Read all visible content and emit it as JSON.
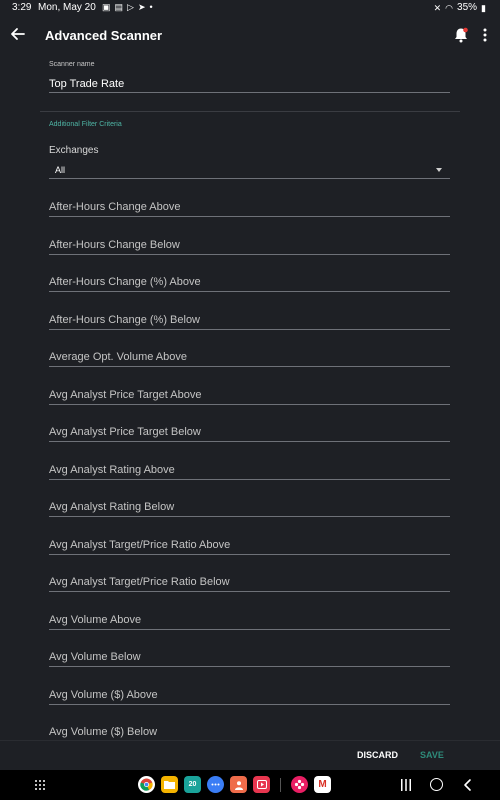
{
  "status_bar": {
    "time": "3:29",
    "date": "Mon, May 20",
    "battery": "35%"
  },
  "app_bar": {
    "title": "Advanced Scanner"
  },
  "scanner_name": {
    "label": "Scanner name",
    "value": "Top Trade Rate"
  },
  "section": {
    "title": "Additional Filter Criteria"
  },
  "exchanges": {
    "label": "Exchanges",
    "selected": "All"
  },
  "filters": [
    "After-Hours Change Above",
    "After-Hours Change Below",
    "After-Hours Change (%) Above",
    "After-Hours Change (%) Below",
    "Average Opt. Volume Above",
    "Avg Analyst Price Target Above",
    "Avg Analyst Price Target Below",
    "Avg Analyst Rating Above",
    "Avg Analyst Rating Below",
    "Avg Analyst Target/Price Ratio Above",
    "Avg Analyst Target/Price Ratio Below",
    "Avg Volume Above",
    "Avg Volume Below",
    "Avg Volume ($) Above",
    "Avg Volume ($) Below"
  ],
  "actions": {
    "discard": "DISCARD",
    "save": "SAVE"
  },
  "dock": {
    "calendar_day": "20",
    "gmail_letter": "M"
  },
  "colors": {
    "background": "#1e2025",
    "accent": "#4fb6a6",
    "save_disabled": "#2e8b7a",
    "notification_dot": "#e53935"
  }
}
